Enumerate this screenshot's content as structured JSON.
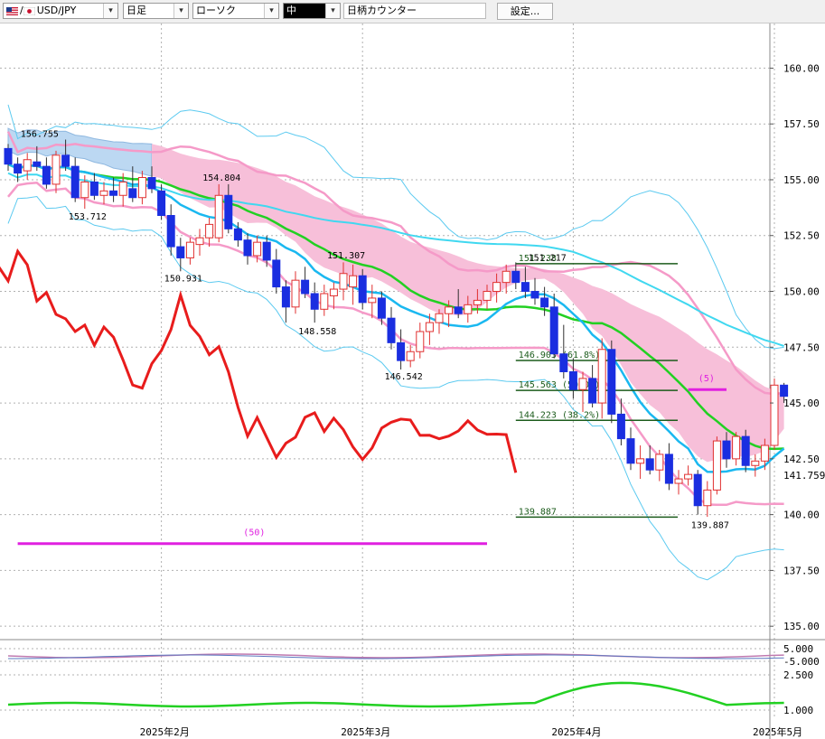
{
  "toolbar": {
    "symbol": "USD/JPY",
    "timeframe": "日足",
    "chart_style": "ローソク",
    "size": "中",
    "counter": "日柄カウンター",
    "settings_label": "設定..."
  },
  "colors": {
    "up_candle": "#ffffff",
    "up_outline": "#e03030",
    "down_candle": "#1a2ee0",
    "ichimoku_cloud": "#f7bfd9",
    "past_cloud": "#bcd8f2",
    "lagging_span": "#e81c1c",
    "ma_green": "#22d022",
    "ma_cyan": "#1ab8f0",
    "bollinger_pink": "#f59ac8",
    "bollinger_outer": "#5ccaf0",
    "fibonacci": "#1c5c1c",
    "counter": "#e020e0"
  },
  "chart_data": {
    "type": "candlestick",
    "instrument": "USD/JPY",
    "timeframe": "日足",
    "ylim": [
      134.4,
      162.0
    ],
    "y_ticks": [
      "160.00",
      "157.50",
      "155.00",
      "152.50",
      "150.00",
      "147.50",
      "145.00",
      "142.50",
      "140.00",
      "137.50",
      "135.00"
    ],
    "y_tick_values": [
      160.0,
      157.5,
      155.0,
      152.5,
      150.0,
      147.5,
      145.0,
      142.5,
      140.0,
      137.5,
      135.0
    ],
    "x_labels": [
      "2025年2月",
      "2025年3月",
      "2025年4月",
      "2025年5月"
    ],
    "x_label_index": [
      16,
      37,
      59,
      80
    ],
    "current_price": "141.759",
    "current_price_value": 141.759,
    "candles": [
      [
        156.4,
        156.6,
        155.4,
        155.7
      ],
      [
        155.7,
        156.0,
        154.9,
        155.3
      ],
      [
        155.4,
        156.2,
        155.0,
        155.9
      ],
      [
        155.8,
        156.5,
        155.4,
        155.6
      ],
      [
        155.6,
        156.0,
        154.6,
        154.8
      ],
      [
        154.8,
        156.3,
        154.4,
        156.1
      ],
      [
        156.1,
        156.8,
        155.4,
        155.6
      ],
      [
        155.6,
        156.0,
        154.0,
        154.2
      ],
      [
        154.2,
        155.2,
        153.7,
        154.9
      ],
      [
        154.9,
        155.3,
        154.1,
        154.3
      ],
      [
        154.3,
        154.9,
        153.9,
        154.5
      ],
      [
        154.5,
        155.1,
        154.0,
        154.3
      ],
      [
        154.3,
        155.3,
        153.8,
        154.9
      ],
      [
        154.6,
        155.6,
        154.0,
        154.2
      ],
      [
        154.2,
        155.4,
        153.9,
        155.1
      ],
      [
        155.1,
        155.6,
        154.4,
        154.6
      ],
      [
        154.5,
        154.8,
        153.2,
        153.4
      ],
      [
        153.4,
        153.9,
        151.6,
        152.0
      ],
      [
        152.0,
        152.4,
        150.9,
        151.5
      ],
      [
        151.5,
        152.4,
        151.2,
        152.2
      ],
      [
        152.1,
        152.8,
        151.6,
        152.4
      ],
      [
        152.4,
        153.3,
        152.0,
        153.0
      ],
      [
        152.4,
        154.8,
        152.2,
        154.3
      ],
      [
        154.3,
        154.8,
        152.6,
        152.8
      ],
      [
        152.8,
        153.1,
        152.0,
        152.3
      ],
      [
        152.3,
        152.6,
        151.2,
        151.6
      ],
      [
        151.6,
        152.5,
        151.3,
        152.2
      ],
      [
        152.2,
        152.5,
        151.1,
        151.4
      ],
      [
        151.4,
        151.9,
        149.9,
        150.2
      ],
      [
        150.2,
        150.5,
        148.6,
        149.3
      ],
      [
        149.3,
        150.9,
        149.0,
        150.5
      ],
      [
        150.5,
        151.1,
        149.7,
        149.9
      ],
      [
        149.9,
        150.4,
        148.6,
        149.2
      ],
      [
        149.2,
        150.3,
        148.9,
        149.9
      ],
      [
        149.8,
        150.4,
        149.2,
        150.1
      ],
      [
        150.1,
        151.3,
        149.6,
        150.8
      ],
      [
        150.2,
        151.2,
        149.4,
        150.7
      ],
      [
        150.7,
        151.0,
        149.2,
        149.5
      ],
      [
        149.5,
        150.3,
        148.8,
        149.7
      ],
      [
        149.7,
        150.0,
        148.5,
        148.8
      ],
      [
        148.8,
        149.3,
        147.4,
        147.7
      ],
      [
        147.7,
        148.3,
        146.5,
        146.9
      ],
      [
        146.9,
        147.6,
        146.6,
        147.3
      ],
      [
        147.3,
        148.6,
        147.0,
        148.2
      ],
      [
        148.2,
        149.0,
        147.6,
        148.6
      ],
      [
        148.6,
        149.2,
        148.1,
        149.0
      ],
      [
        149.0,
        149.6,
        148.4,
        149.3
      ],
      [
        149.3,
        150.1,
        148.8,
        149.0
      ],
      [
        149.0,
        149.8,
        148.6,
        149.4
      ],
      [
        149.4,
        150.1,
        149.0,
        149.6
      ],
      [
        149.6,
        150.3,
        149.2,
        150.0
      ],
      [
        150.0,
        150.8,
        149.5,
        150.4
      ],
      [
        150.4,
        151.2,
        149.9,
        150.9
      ],
      [
        150.9,
        151.3,
        150.1,
        150.4
      ],
      [
        150.4,
        151.1,
        149.7,
        150.0
      ],
      [
        150.0,
        150.6,
        149.4,
        149.7
      ],
      [
        149.7,
        150.2,
        148.9,
        149.3
      ],
      [
        149.3,
        149.9,
        147.0,
        147.2
      ],
      [
        147.2,
        148.5,
        146.1,
        146.4
      ],
      [
        146.4,
        147.0,
        145.2,
        145.6
      ],
      [
        145.6,
        146.4,
        144.6,
        146.1
      ],
      [
        146.1,
        146.7,
        144.8,
        145.0
      ],
      [
        145.0,
        147.9,
        144.3,
        147.4
      ],
      [
        147.4,
        147.8,
        144.1,
        144.5
      ],
      [
        144.5,
        145.2,
        143.1,
        143.4
      ],
      [
        143.4,
        143.9,
        142.0,
        142.3
      ],
      [
        142.3,
        143.1,
        141.6,
        142.5
      ],
      [
        142.5,
        143.1,
        141.8,
        142.0
      ],
      [
        142.0,
        142.9,
        141.5,
        142.7
      ],
      [
        142.7,
        143.2,
        141.1,
        141.4
      ],
      [
        141.4,
        142.0,
        140.9,
        141.6
      ],
      [
        141.6,
        142.2,
        141.3,
        141.8
      ],
      [
        141.8,
        142.0,
        140.0,
        140.4
      ],
      [
        140.4,
        141.5,
        139.9,
        141.1
      ],
      [
        141.1,
        143.5,
        140.9,
        143.3
      ],
      [
        143.3,
        143.7,
        142.1,
        142.5
      ],
      [
        142.5,
        143.7,
        142.2,
        143.5
      ],
      [
        143.5,
        143.8,
        141.9,
        142.2
      ],
      [
        142.2,
        142.7,
        141.7,
        142.4
      ],
      [
        142.4,
        143.4,
        142.0,
        143.1
      ],
      [
        143.1,
        146.1,
        142.9,
        145.8
      ],
      [
        145.8,
        145.9,
        145.0,
        145.3
      ]
    ],
    "price_labels": [
      {
        "text": "156.755",
        "index": 3,
        "value": 156.755,
        "pos": "above"
      },
      {
        "text": "153.712",
        "index": 8,
        "value": 153.712,
        "pos": "below"
      },
      {
        "text": "154.804",
        "index": 22,
        "value": 154.804,
        "pos": "above"
      },
      {
        "text": "150.931",
        "index": 18,
        "value": 150.931,
        "pos": "below"
      },
      {
        "text": "151.307",
        "index": 35,
        "value": 151.307,
        "pos": "above"
      },
      {
        "text": "148.558",
        "index": 32,
        "value": 148.558,
        "pos": "below"
      },
      {
        "text": "146.542",
        "index": 41,
        "value": 146.542,
        "pos": "below"
      },
      {
        "text": "151.217",
        "index": 56,
        "value": 151.217,
        "pos": "above"
      },
      {
        "text": "139.887",
        "index": 73,
        "value": 139.887,
        "pos": "below"
      }
    ],
    "fibonacci": [
      {
        "label": "151.238",
        "value": 151.238
      },
      {
        "label": "146.903 (61.8%)",
        "value": 146.903
      },
      {
        "label": "145.563 (50.0%)",
        "value": 145.563
      },
      {
        "label": "144.223 (38.2%)",
        "value": 144.223
      },
      {
        "label": "139.887",
        "value": 139.887
      }
    ],
    "counters": [
      {
        "label": "(50)",
        "from": 1,
        "to": 50,
        "value": 138.7
      },
      {
        "label": "(5)",
        "from": 71,
        "to": 75,
        "value": 145.6
      }
    ],
    "oscillator_ticks": [
      "5.000",
      "-5.000",
      "2.500",
      "1.000"
    ],
    "oscillator_tick_values": [
      5.0,
      -5.0,
      2.5,
      1.0
    ]
  }
}
